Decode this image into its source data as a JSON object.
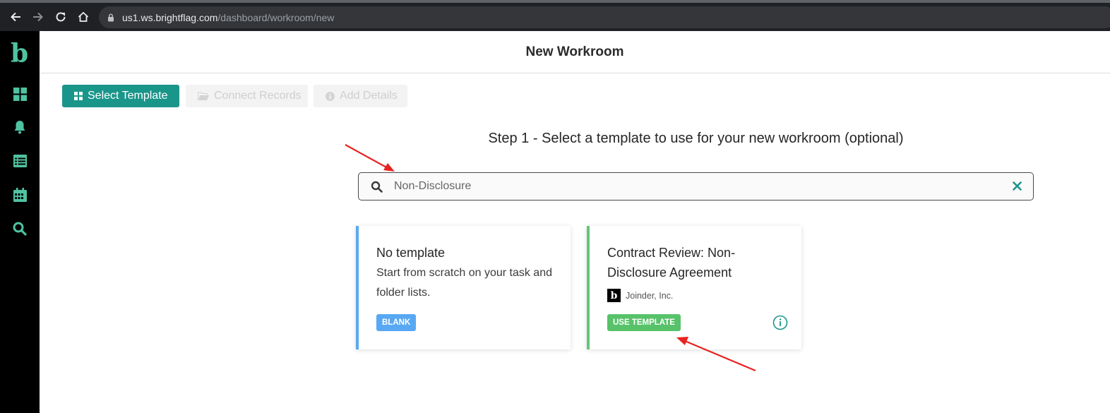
{
  "browser": {
    "url_host": "us1.ws.brightflag.com",
    "url_path": "/dashboard/workroom/new",
    "icons": [
      "back-icon",
      "forward-icon",
      "reload-icon",
      "home-icon",
      "lock-icon"
    ]
  },
  "sidebar": {
    "logo": "b",
    "items": [
      {
        "icon": "dashboard-grid-icon"
      },
      {
        "icon": "bell-icon"
      },
      {
        "icon": "list-icon"
      },
      {
        "icon": "calendar-icon"
      },
      {
        "icon": "search-icon"
      }
    ]
  },
  "header": {
    "title": "New Workroom"
  },
  "steps": [
    {
      "label": "Select Template",
      "icon": "grid-icon",
      "state": "active"
    },
    {
      "label": "Connect Records",
      "icon": "folder-icon",
      "state": "disabled"
    },
    {
      "label": "Add Details",
      "icon": "info-icon",
      "state": "disabled"
    }
  ],
  "step_heading": "Step 1 - Select a template to use for your new workroom (optional)",
  "search": {
    "value": "Non-Disclosure",
    "placeholder": ""
  },
  "cards": [
    {
      "title": "No template",
      "description": "Start from scratch on your task and folder lists.",
      "badge": "BLANK"
    },
    {
      "title": "Contract Review: Non-Disclosure Agreement",
      "publisher": "Joinder, Inc.",
      "publisher_logo": "b",
      "badge": "USE TEMPLATE"
    }
  ],
  "colors": {
    "accent": "#1a958a",
    "sidebar_bg": "#000000",
    "logo": "#4fc3a1",
    "blank_badge": "#58a8f3",
    "use_badge": "#57c26a",
    "annotation_arrow": "#e8231f"
  }
}
